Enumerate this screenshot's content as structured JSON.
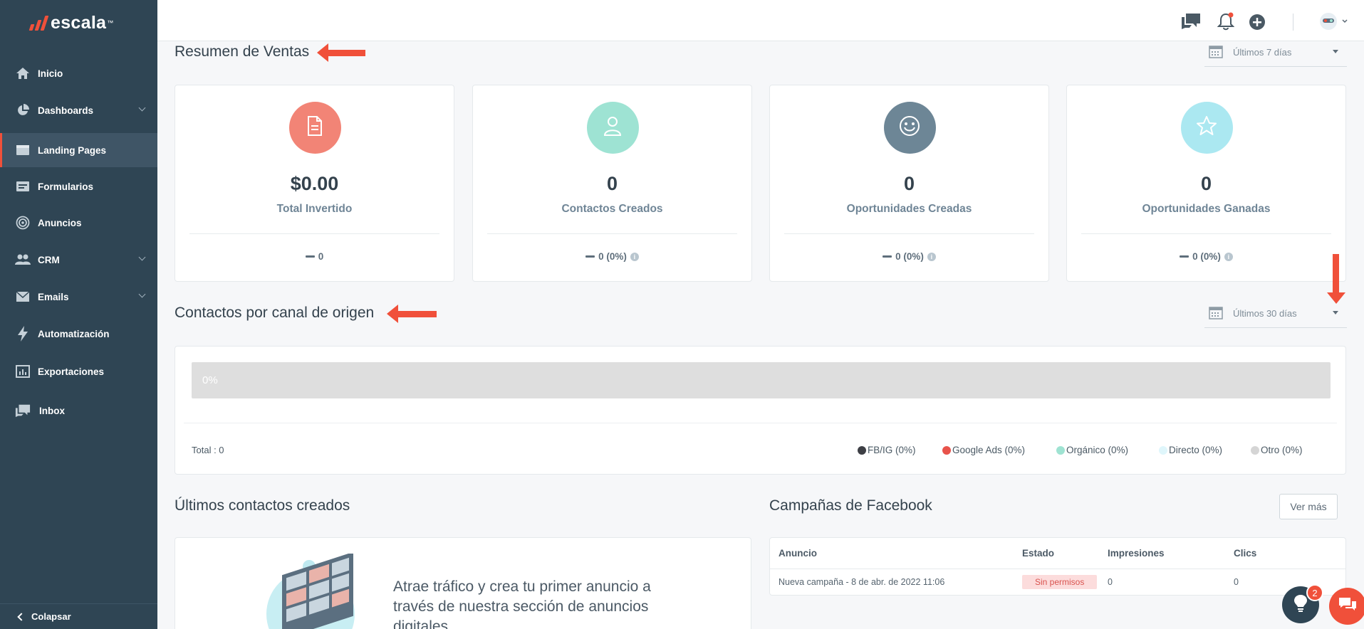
{
  "app": {
    "brand": "escala",
    "brand_tm": "™"
  },
  "sidebar": {
    "items": [
      {
        "label": "Inicio"
      },
      {
        "label": "Dashboards"
      },
      {
        "label": "Landing Pages"
      },
      {
        "label": "Formularios"
      },
      {
        "label": "Anuncios"
      },
      {
        "label": "CRM"
      },
      {
        "label": "Emails"
      },
      {
        "label": "Automatización"
      },
      {
        "label": "Exportaciones"
      },
      {
        "label": "Inbox"
      }
    ],
    "collapse_label": "Colapsar"
  },
  "sales_summary": {
    "title": "Resumen de Ventas",
    "range": "Últimos 7 días",
    "cards": [
      {
        "value": "$0.00",
        "label": "Total Invertido",
        "delta": "0",
        "color": "#f28476",
        "icon": "document-icon"
      },
      {
        "value": "0",
        "label": "Contactos Creados",
        "delta": "0 (0%)",
        "color": "#9ee3d3",
        "icon": "person-icon"
      },
      {
        "value": "0",
        "label": "Oportunidades Creadas",
        "delta": "0 (0%)",
        "color": "#6d8696",
        "icon": "smiley-icon"
      },
      {
        "value": "0",
        "label": "Oportunidades Ganadas",
        "delta": "0 (0%)",
        "color": "#abe8f1",
        "icon": "star-icon"
      }
    ]
  },
  "origin": {
    "title": "Contactos por canal de origen",
    "range": "Últimos 30 días",
    "bar_label": "0%",
    "total": "Total : 0",
    "legend": [
      {
        "label": "FB/IG (0%)",
        "color": "#3d3f45"
      },
      {
        "label": "Google Ads (0%)",
        "color": "#e8534b"
      },
      {
        "label": "Orgánico (0%)",
        "color": "#9fe3d2"
      },
      {
        "label": "Directo (0%)",
        "color": "#dff6fb"
      },
      {
        "label": "Otro (0%)",
        "color": "#d5d5d5"
      }
    ]
  },
  "recent_contacts": {
    "title": "Últimos contactos creados",
    "empty_text": "Atrae tráfico y crea tu primer anuncio a través de nuestra sección de anuncios digitales."
  },
  "facebook": {
    "title": "Campañas de Facebook",
    "see_more": "Ver más",
    "headers": [
      "Anuncio",
      "Estado",
      "Impresiones",
      "Clics"
    ],
    "rows": [
      {
        "anuncio": "Nueva campaña - 8 de abr. de 2022 11:06",
        "estado": "Sin permisos",
        "impresiones": "0",
        "clics": "0"
      }
    ]
  },
  "help": {
    "badge": "2"
  },
  "colors": {
    "sidebar": "#2f4554",
    "accent": "#f0503a"
  }
}
